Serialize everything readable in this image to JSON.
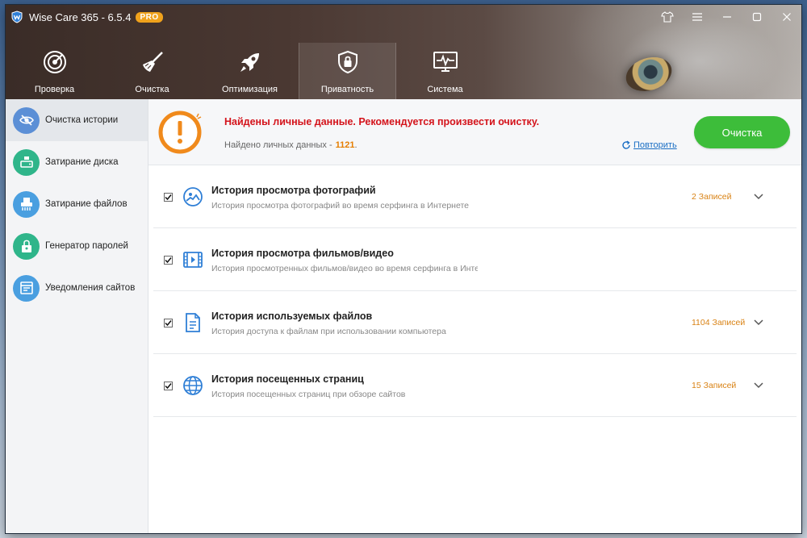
{
  "app": {
    "title": "Wise Care 365 - 6.5.4",
    "badge": "PRO"
  },
  "window_controls": [
    {
      "name": "skin-icon",
      "glyph": "👕"
    },
    {
      "name": "menu-icon",
      "glyph": "≡"
    },
    {
      "name": "minimize-icon",
      "glyph": "—"
    },
    {
      "name": "maximize-icon",
      "glyph": "☐"
    },
    {
      "name": "close-icon",
      "glyph": "✕"
    }
  ],
  "nav": {
    "active": "privacy",
    "tabs": [
      {
        "id": "check",
        "label": "Проверка",
        "icon": "radar-icon"
      },
      {
        "id": "clean",
        "label": "Очистка",
        "icon": "broom-icon"
      },
      {
        "id": "optimize",
        "label": "Оптимизация",
        "icon": "rocket-icon"
      },
      {
        "id": "privacy",
        "label": "Приватность",
        "icon": "shield-lock-icon"
      },
      {
        "id": "system",
        "label": "Система",
        "icon": "monitor-pulse-icon"
      }
    ]
  },
  "sidebar": {
    "items": [
      {
        "label": "Очистка истории",
        "icon": "eye-slash-icon",
        "color": "#5b8fd6"
      },
      {
        "label": "Затирание диска",
        "icon": "disk-eraser-icon",
        "color": "#2fb58a"
      },
      {
        "label": "Затирание файлов",
        "icon": "shredder-icon",
        "color": "#4a9fe0"
      },
      {
        "label": "Генератор паролей",
        "icon": "lock-key-icon",
        "color": "#2fb58a"
      },
      {
        "label": "Уведомления сайтов",
        "icon": "site-notification-icon",
        "color": "#4a9fe0"
      }
    ]
  },
  "alert": {
    "title": "Найдены личные данные. Рекомендуется произвести очистку.",
    "sub_label": "Найдено личных данных -",
    "count": "1121",
    "sub_suffix": ".",
    "rescan_label": "Повторить",
    "clean_button": "Очистка",
    "colors": {
      "title": "#d4131b",
      "count": "#e67e00",
      "button": "#3dbd3a",
      "warning_ring": "#f08a1c"
    }
  },
  "items": [
    {
      "title": "История просмотра фотографий",
      "desc": "История просмотра фотографий во время серфинга в Интернете",
      "count": "2 Записей",
      "icon": "photo-icon",
      "checked": true
    },
    {
      "title": "История просмотра фильмов/видео",
      "desc": "История просмотренных фильмов/видео во время серфинга в Инте...",
      "count": "",
      "icon": "film-icon",
      "checked": true
    },
    {
      "title": "История используемых файлов",
      "desc": "История доступа к файлам при использовании компьютера",
      "count": "1104 Записей",
      "icon": "document-icon",
      "checked": true
    },
    {
      "title": "История посещенных страниц",
      "desc": "История посещенных страниц при обзоре сайтов",
      "count": "15 Записей",
      "icon": "globe-icon",
      "checked": true
    }
  ]
}
